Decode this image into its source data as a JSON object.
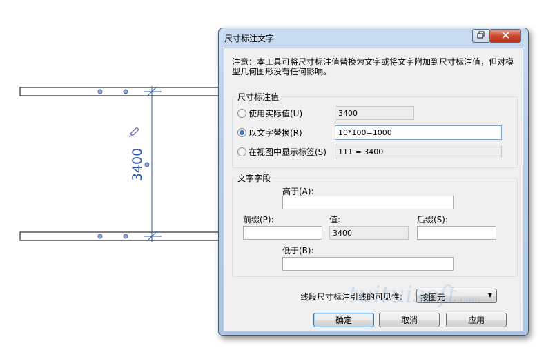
{
  "drawing": {
    "dimension_text": "3400"
  },
  "dialog": {
    "title": "尺寸标注文字",
    "note": "注意：本工具可将尺寸标注值替换为文字或将文字附加到尺寸标注值，但对模型几何图形没有任何影响。",
    "value_group": {
      "label": "尺寸标注值",
      "options": [
        {
          "label": "使用实际值(U)",
          "value": "3400",
          "selected": false
        },
        {
          "label": "以文字替换(R)",
          "value": "10*100=1000",
          "selected": true
        },
        {
          "label": "在视图中显示标签(S)",
          "value": "111 = 3400",
          "selected": false
        }
      ]
    },
    "text_group": {
      "label": "文字字段",
      "above_label": "高于(A):",
      "above_value": "",
      "prefix_label": "前缀(P):",
      "prefix_value": "",
      "value_label": "值:",
      "value_value": "3400",
      "suffix_label": "后缀(S):",
      "suffix_value": "",
      "below_label": "低于(B):",
      "below_value": ""
    },
    "visibility_label": "线段尺寸标注引线的可见性:",
    "visibility_value": "按图元",
    "buttons": {
      "ok": "确定",
      "cancel": "取消",
      "apply": "应用"
    }
  },
  "watermark": {
    "text": "tuituisoft",
    "suffix": ".com"
  },
  "colors": {
    "dimension_blue": "#2b55a3",
    "close_red": "#c9452a"
  },
  "icons": {
    "restore": "restore-icon",
    "close": "close-icon",
    "edit": "pencil-icon",
    "dropdown": "chevron-down-icon"
  }
}
